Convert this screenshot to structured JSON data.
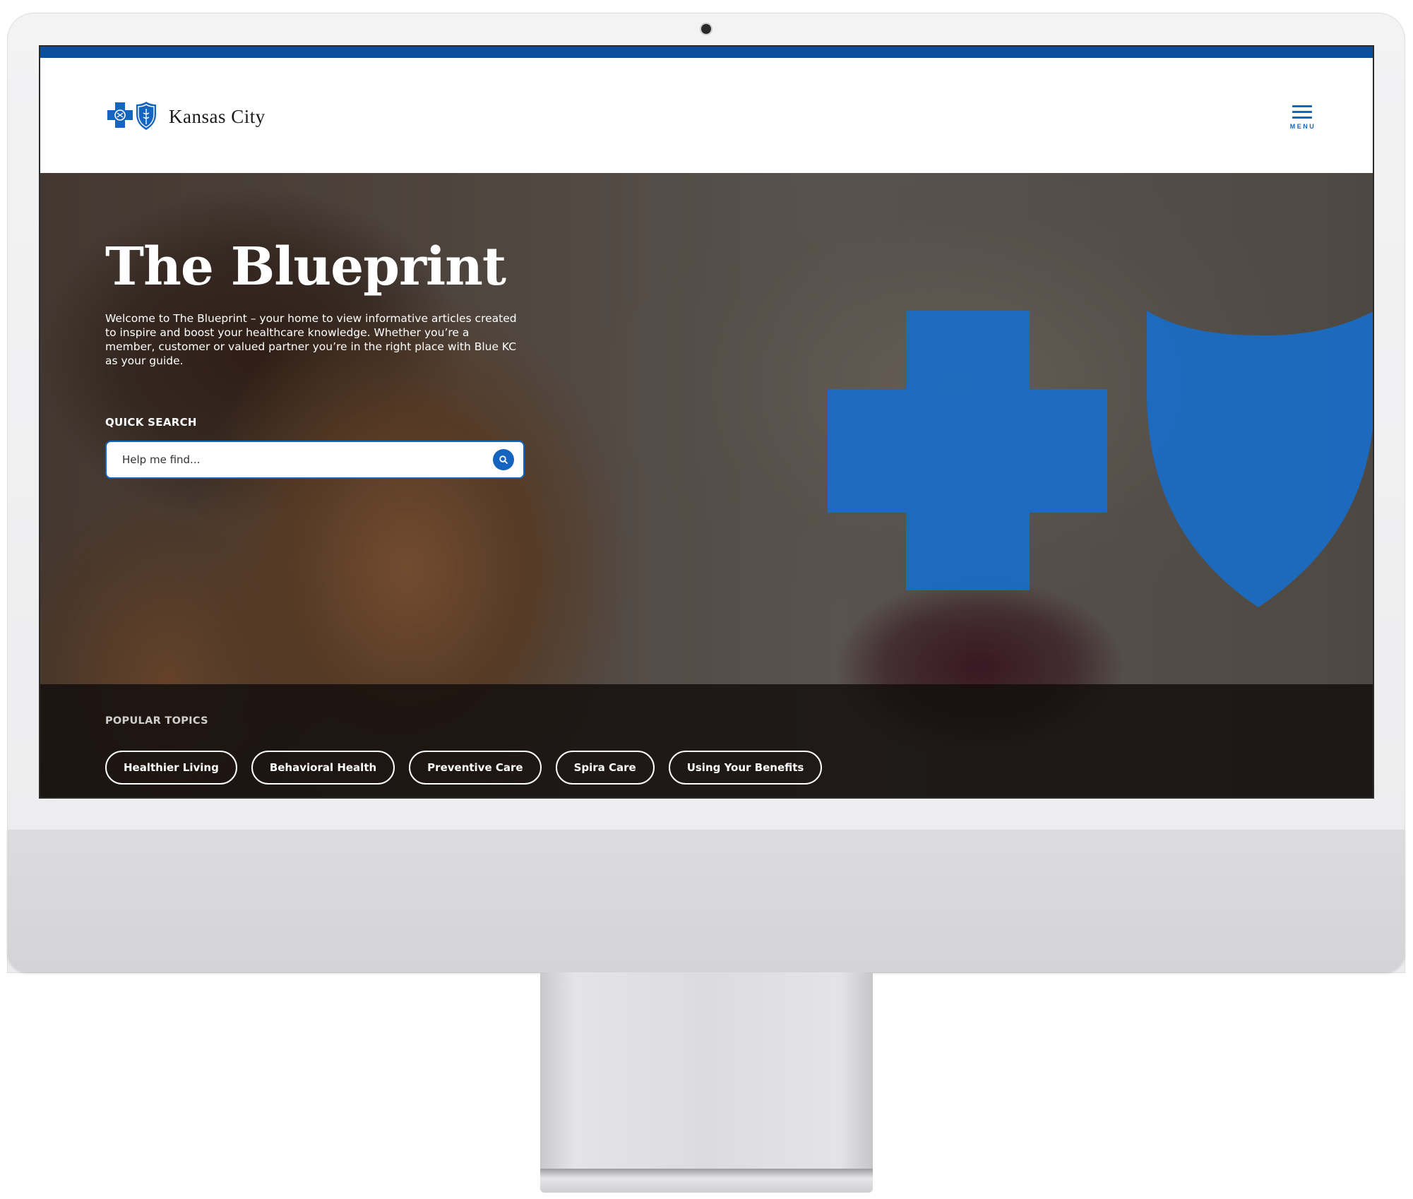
{
  "brand": {
    "name": "Kansas City",
    "primary_color": "#1565c0",
    "top_bar_color": "#0b4f9c"
  },
  "header": {
    "menu_label": "MENU"
  },
  "hero": {
    "title": "The Blueprint",
    "intro": "Welcome to The Blueprint – your home to view informative articles created to inspire and boost your healthcare knowledge. Whether you’re a member, customer or valued partner you’re in the right place with Blue KC as your guide.",
    "quick_search": {
      "label": "QUICK SEARCH",
      "placeholder": "Help me find...",
      "value": "",
      "submit_icon": "search-icon"
    },
    "art": [
      "cross-icon",
      "shield-icon"
    ]
  },
  "popular_topics": {
    "label": "POPULAR TOPICS",
    "items": [
      {
        "label": "Healthier Living"
      },
      {
        "label": "Behavioral Health"
      },
      {
        "label": "Preventive Care"
      },
      {
        "label": "Spira Care"
      },
      {
        "label": "Using Your Benefits"
      }
    ]
  }
}
